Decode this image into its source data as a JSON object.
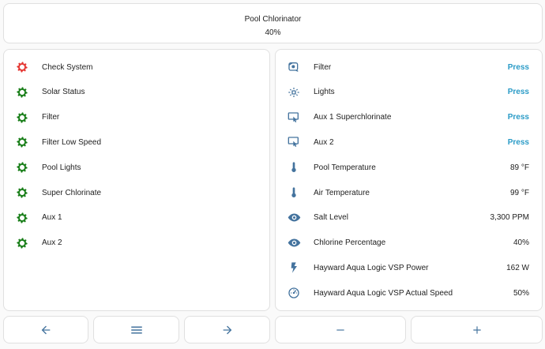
{
  "header": {
    "title": "Pool Chlorinator",
    "value": "40%"
  },
  "colors": {
    "gear_green": "#1a7f1a",
    "gear_red": "#e53935",
    "icon_blue": "#44739e",
    "accent": "#2a9bc7"
  },
  "left_panel": {
    "items": [
      {
        "label": "Check System",
        "icon": "gear-icon",
        "color": "#e53935"
      },
      {
        "label": "Solar Status",
        "icon": "gear-icon",
        "color": "#1a7f1a"
      },
      {
        "label": "Filter",
        "icon": "gear-icon",
        "color": "#1a7f1a"
      },
      {
        "label": "Filter Low Speed",
        "icon": "gear-icon",
        "color": "#1a7f1a"
      },
      {
        "label": "Pool Lights",
        "icon": "gear-icon",
        "color": "#1a7f1a"
      },
      {
        "label": "Super Chlorinate",
        "icon": "gear-icon",
        "color": "#1a7f1a"
      },
      {
        "label": "Aux 1",
        "icon": "gear-icon",
        "color": "#1a7f1a"
      },
      {
        "label": "Aux 2",
        "icon": "gear-icon",
        "color": "#1a7f1a"
      }
    ]
  },
  "right_panel": {
    "items": [
      {
        "label": "Filter",
        "icon": "filter-pump-icon",
        "action": "Press"
      },
      {
        "label": "Lights",
        "icon": "light-icon",
        "action": "Press"
      },
      {
        "label": "Aux 1 Superchlorinate",
        "icon": "touch-button-icon",
        "action": "Press"
      },
      {
        "label": "Aux 2",
        "icon": "touch-button-icon",
        "action": "Press"
      },
      {
        "label": "Pool Temperature",
        "icon": "thermometer-icon",
        "value": "89 °F"
      },
      {
        "label": "Air Temperature",
        "icon": "thermometer-icon",
        "value": "99 °F"
      },
      {
        "label": "Salt Level",
        "icon": "eye-icon",
        "value": "3,300 PPM"
      },
      {
        "label": "Chlorine Percentage",
        "icon": "eye-icon",
        "value": "40%"
      },
      {
        "label": "Hayward Aqua Logic VSP Power",
        "icon": "flash-icon",
        "value": "162 W"
      },
      {
        "label": "Hayward Aqua Logic VSP Actual Speed",
        "icon": "gauge-icon",
        "value": "50%"
      }
    ]
  },
  "toolbar": {
    "buttons": [
      {
        "name": "back-button",
        "icon": "arrow-left-icon"
      },
      {
        "name": "menu-button",
        "icon": "menu-icon"
      },
      {
        "name": "forward-button",
        "icon": "arrow-right-icon"
      },
      {
        "name": "decrease-button",
        "icon": "minus-icon"
      },
      {
        "name": "increase-button",
        "icon": "plus-icon"
      }
    ]
  }
}
